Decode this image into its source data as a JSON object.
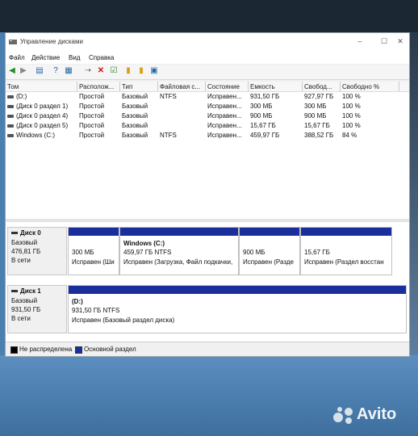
{
  "window": {
    "title": "Управление дисками",
    "minimize": "–",
    "maximize": "☐",
    "close": "✕"
  },
  "menu": [
    "Файл",
    "Действие",
    "Вид",
    "Справка"
  ],
  "toolbar": [
    "back-icon",
    "forward-icon",
    "properties-icon",
    "help-icon",
    "connect-icon",
    "delete-icon",
    "check-icon",
    "folder-icon",
    "folder-new-icon",
    "snapin-icon"
  ],
  "volumes": {
    "headers": [
      "Том",
      "Располож...",
      "Тип",
      "Файловая с...",
      "Состояние",
      "Емкость",
      "Свобод...",
      "Свободно %"
    ],
    "rows": [
      [
        "(D:)",
        "Простой",
        "Базовый",
        "NTFS",
        "Исправен...",
        "931,50 ГБ",
        "927,97 ГБ",
        "100 %"
      ],
      [
        "(Диск 0 раздел 1)",
        "Простой",
        "Базовый",
        "",
        "Исправен...",
        "300 МБ",
        "300 МБ",
        "100 %"
      ],
      [
        "(Диск 0 раздел 4)",
        "Простой",
        "Базовый",
        "",
        "Исправен...",
        "900 МБ",
        "900 МБ",
        "100 %"
      ],
      [
        "(Диск 0 раздел 5)",
        "Простой",
        "Базовый",
        "",
        "Исправен...",
        "15,67 ГБ",
        "15,67 ГБ",
        "100 %"
      ],
      [
        "Windows (C:)",
        "Простой",
        "Базовый",
        "NTFS",
        "Исправен...",
        "459,97 ГБ",
        "388,52 ГБ",
        "84 %"
      ]
    ]
  },
  "disks": [
    {
      "name": "Диск 0",
      "type": "Базовый",
      "size": "476,81 ГБ",
      "status": "В сети",
      "partitions": [
        {
          "name": "",
          "size": "300 МБ",
          "state": "Исправен (Ши"
        },
        {
          "name": "Windows (C:)",
          "size": "459,97 ГБ NTFS",
          "state": "Исправен (Загрузка, Файл подкачки,"
        },
        {
          "name": "",
          "size": "900 МБ",
          "state": "Исправен (Разде"
        },
        {
          "name": "",
          "size": "15,67 ГБ",
          "state": "Исправен (Раздел восстан"
        }
      ]
    },
    {
      "name": "Диск 1",
      "type": "Базовый",
      "size": "931,50 ГБ",
      "status": "В сети",
      "partitions": [
        {
          "name": "(D:)",
          "size": "931,50 ГБ NTFS",
          "state": "Исправен (Базовый раздел диска)"
        }
      ]
    }
  ],
  "legend": [
    {
      "label": "Не распределена",
      "color": "#000000"
    },
    {
      "label": "Основной раздел",
      "color": "#1a2f9c"
    }
  ],
  "watermark": "Avito",
  "colors": {
    "partition_bar": "#1a2f9c",
    "window_bg": "#f0f0f0",
    "desktop": "#4a7fb0"
  }
}
